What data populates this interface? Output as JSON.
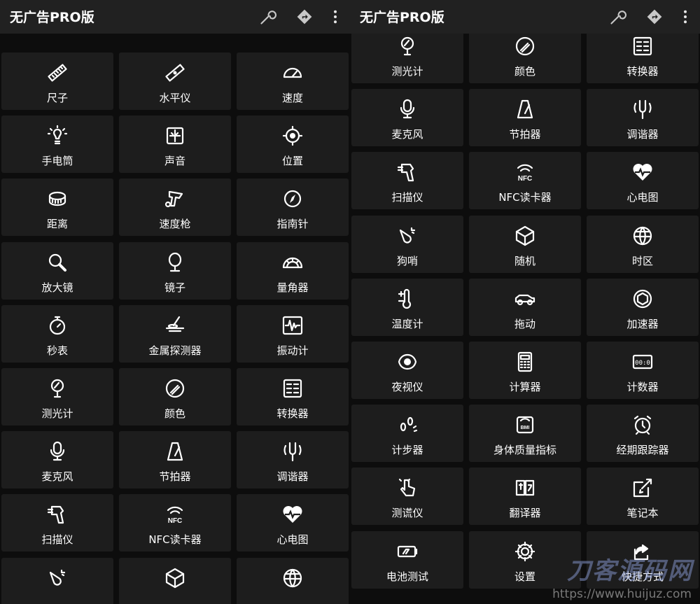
{
  "left": {
    "title": "无广告PRO版",
    "tools": [
      {
        "label": "尺子",
        "icon": "ruler-icon"
      },
      {
        "label": "水平仪",
        "icon": "level-icon"
      },
      {
        "label": "速度",
        "icon": "speedometer-icon"
      },
      {
        "label": "手电筒",
        "icon": "flashlight-icon"
      },
      {
        "label": "声音",
        "icon": "sound-meter-icon"
      },
      {
        "label": "位置",
        "icon": "location-icon"
      },
      {
        "label": "距离",
        "icon": "distance-icon"
      },
      {
        "label": "速度枪",
        "icon": "speed-gun-icon"
      },
      {
        "label": "指南针",
        "icon": "compass-icon"
      },
      {
        "label": "放大镜",
        "icon": "magnifier-icon"
      },
      {
        "label": "镜子",
        "icon": "mirror-icon"
      },
      {
        "label": "量角器",
        "icon": "protractor-icon"
      },
      {
        "label": "秒表",
        "icon": "stopwatch-icon"
      },
      {
        "label": "金属探测器",
        "icon": "metal-detector-icon"
      },
      {
        "label": "振动计",
        "icon": "vibrometer-icon"
      },
      {
        "label": "测光计",
        "icon": "light-meter-icon"
      },
      {
        "label": "颜色",
        "icon": "color-icon"
      },
      {
        "label": "转换器",
        "icon": "converter-icon"
      },
      {
        "label": "麦克风",
        "icon": "microphone-icon"
      },
      {
        "label": "节拍器",
        "icon": "metronome-icon"
      },
      {
        "label": "调谐器",
        "icon": "tuner-icon"
      },
      {
        "label": "扫描仪",
        "icon": "scanner-icon"
      },
      {
        "label": "NFC读卡器",
        "icon": "nfc-icon"
      },
      {
        "label": "心电图",
        "icon": "heart-rate-icon"
      },
      {
        "label": "",
        "icon": "dog-whistle-icon"
      },
      {
        "label": "",
        "icon": "dice-icon"
      },
      {
        "label": "",
        "icon": "globe-icon"
      }
    ]
  },
  "right": {
    "title": "无广告PRO版",
    "tools": [
      {
        "label": "测光计",
        "icon": "light-meter-icon"
      },
      {
        "label": "颜色",
        "icon": "color-icon"
      },
      {
        "label": "转换器",
        "icon": "converter-icon"
      },
      {
        "label": "麦克风",
        "icon": "microphone-icon"
      },
      {
        "label": "节拍器",
        "icon": "metronome-icon"
      },
      {
        "label": "调谐器",
        "icon": "tuner-icon"
      },
      {
        "label": "扫描仪",
        "icon": "scanner-icon"
      },
      {
        "label": "NFC读卡器",
        "icon": "nfc-icon"
      },
      {
        "label": "心电图",
        "icon": "heart-rate-icon"
      },
      {
        "label": "狗哨",
        "icon": "dog-whistle-icon"
      },
      {
        "label": "随机",
        "icon": "dice-icon"
      },
      {
        "label": "时区",
        "icon": "globe-icon"
      },
      {
        "label": "温度计",
        "icon": "thermometer-icon"
      },
      {
        "label": "拖动",
        "icon": "tow-car-icon"
      },
      {
        "label": "加速器",
        "icon": "accelerometer-icon"
      },
      {
        "label": "夜视仪",
        "icon": "night-vision-icon"
      },
      {
        "label": "计算器",
        "icon": "calculator-icon"
      },
      {
        "label": "计数器",
        "icon": "counter-icon"
      },
      {
        "label": "计步器",
        "icon": "pedometer-icon"
      },
      {
        "label": "身体质量指标",
        "icon": "bmi-icon"
      },
      {
        "label": "经期跟踪器",
        "icon": "alarm-clock-icon"
      },
      {
        "label": "测谎仪",
        "icon": "lie-detector-icon"
      },
      {
        "label": "翻译器",
        "icon": "translator-icon"
      },
      {
        "label": "笔记本",
        "icon": "notebook-icon"
      },
      {
        "label": "电池测试",
        "icon": "battery-icon"
      },
      {
        "label": "设置",
        "icon": "settings-gear-icon"
      },
      {
        "label": "快捷方式",
        "icon": "shortcut-icon"
      }
    ]
  },
  "icon_glyph_text": {
    "nfc": "NFC",
    "bmi": "BMI",
    "counter": "00:0"
  },
  "colors": {
    "appbar": "#212121",
    "tile": "#1d1d1d",
    "background": "#0d0d0d"
  },
  "watermark": {
    "brand": "刀客源码网",
    "url": "https://www.huijuz.com"
  }
}
